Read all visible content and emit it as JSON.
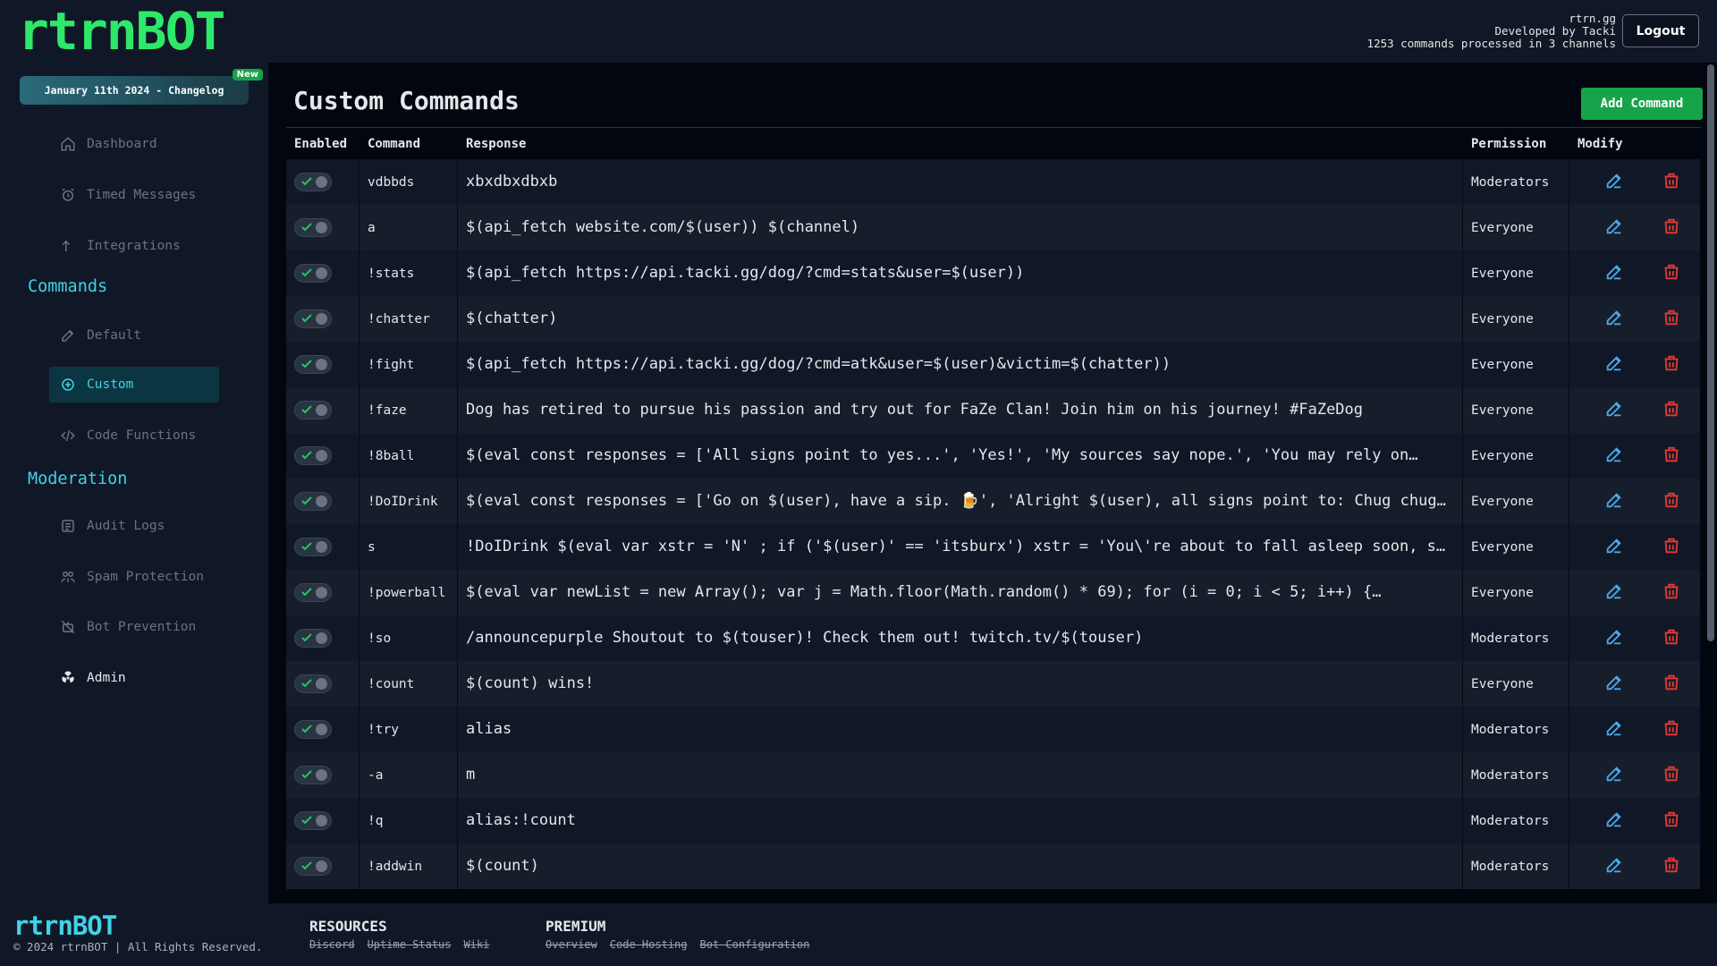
{
  "header": {
    "logo": "rtrnBOT",
    "site": "rtrn.gg",
    "developer": "Developed by Tacki",
    "stats": "1253 commands processed in 3 channels",
    "logout_label": "Logout"
  },
  "sidebar": {
    "changelog": "January 11th 2024 - Changelog",
    "new_badge": "New",
    "items_top": [
      {
        "label": "Dashboard",
        "icon": "home-icon"
      },
      {
        "label": "Timed Messages",
        "icon": "alarm-icon"
      },
      {
        "label": "Integrations",
        "icon": "arrow-up-icon"
      }
    ],
    "commands_title": "Commands",
    "commands_items": [
      {
        "label": "Default",
        "icon": "edit-icon"
      },
      {
        "label": "Custom",
        "icon": "plus-circle-icon"
      },
      {
        "label": "Code Functions",
        "icon": "code-icon"
      }
    ],
    "moderation_title": "Moderation",
    "moderation_items": [
      {
        "label": "Audit Logs",
        "icon": "list-icon"
      },
      {
        "label": "Spam Protection",
        "icon": "users-icon"
      },
      {
        "label": "Bot Prevention",
        "icon": "robot-off-icon"
      },
      {
        "label": "Admin",
        "icon": "radiation-icon"
      }
    ]
  },
  "main": {
    "title": "Custom Commands",
    "add_label": "Add Command",
    "columns": [
      "Enabled",
      "Command",
      "Response",
      "Permission",
      "Modify"
    ],
    "rows": [
      {
        "command": "vdbbds",
        "response": "xbxdbxdbxb",
        "permission": "Moderators"
      },
      {
        "command": "a",
        "response": "$(api_fetch website.com/$(user)) $(channel)",
        "permission": "Everyone"
      },
      {
        "command": "!stats",
        "response": "$(api_fetch https://api.tacki.gg/dog/?cmd=stats&user=$(user))",
        "permission": "Everyone"
      },
      {
        "command": "!chatter",
        "response": "$(chatter)",
        "permission": "Everyone"
      },
      {
        "command": "!fight",
        "response": "$(api_fetch https://api.tacki.gg/dog/?cmd=atk&user=$(user)&victim=$(chatter))",
        "permission": "Everyone"
      },
      {
        "command": "!faze",
        "response": "Dog has retired to pursue his passion and try out for FaZe Clan! Join him on his journey! #FaZeDog",
        "permission": "Everyone"
      },
      {
        "command": "!8ball",
        "response": "$(eval const responses = ['All signs point to yes...', 'Yes!', 'My sources say nope.', 'You may rely on…",
        "permission": "Everyone"
      },
      {
        "command": "!DoIDrink",
        "response": "$(eval const responses = ['Go on $(user), have a sip. 🍺', 'Alright $(user), all signs point to: Chug chug…",
        "permission": "Everyone"
      },
      {
        "command": "s",
        "response": "!DoIDrink $(eval var xstr = 'N' ; if ('$(user)' == 'itsburx') xstr = 'You\\'re about to fall asleep soon, so…",
        "permission": "Everyone"
      },
      {
        "command": "!powerball",
        "response": "$(eval var newList = new Array(); var j = Math.floor(Math.random() * 69); for (i = 0; i < 5; i++) {…",
        "permission": "Everyone"
      },
      {
        "command": "!so",
        "response": "/announcepurple Shoutout to $(touser)! Check them out! twitch.tv/$(touser)",
        "permission": "Moderators"
      },
      {
        "command": "!count",
        "response": "$(count) wins!",
        "permission": "Everyone"
      },
      {
        "command": "!try",
        "response": "alias",
        "permission": "Moderators"
      },
      {
        "command": "-a",
        "response": "m",
        "permission": "Moderators"
      },
      {
        "command": "!q",
        "response": "alias:!count",
        "permission": "Moderators"
      },
      {
        "command": "!addwin",
        "response": "$(count)",
        "permission": "Moderators"
      }
    ]
  },
  "footer": {
    "logo": "rtrnBOT",
    "copyright": "© 2024 rtrnBOT | All Rights Reserved.",
    "resources_title": "RESOURCES",
    "resources_links": [
      "Discord",
      "Uptime Status",
      "Wiki"
    ],
    "premium_title": "PREMIUM",
    "premium_links": [
      "Overview",
      "Code Hosting",
      "Bot Configuration"
    ]
  },
  "colors": {
    "accent": "#3fd3e6",
    "logo_green": "#2ee86a",
    "add_button": "#16a34a",
    "edit_icon": "#4ea8e8",
    "delete_icon": "#e53935"
  }
}
